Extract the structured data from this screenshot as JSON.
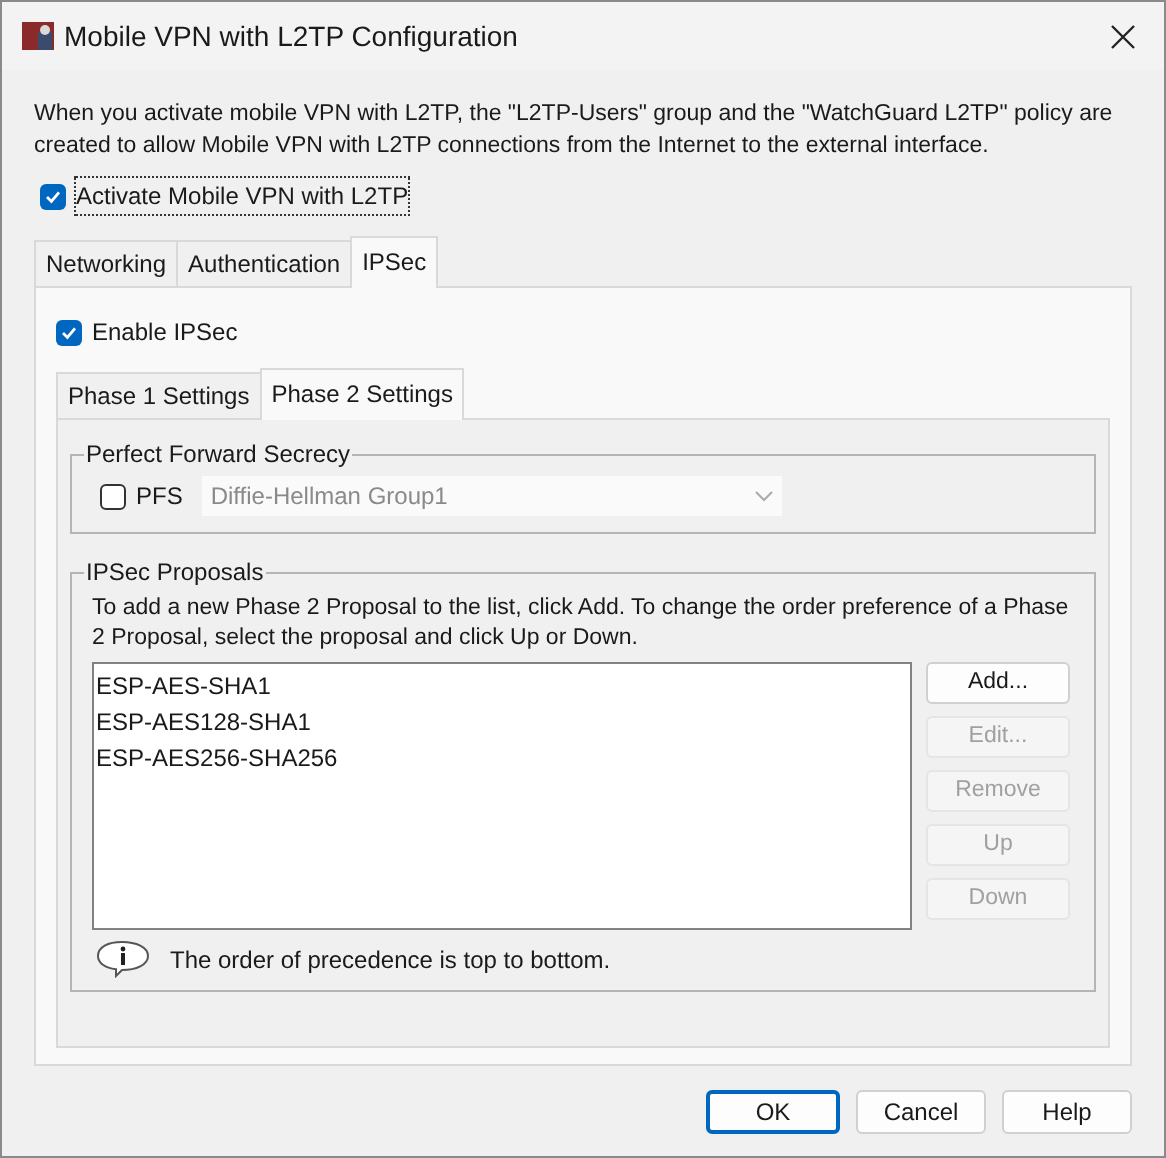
{
  "window": {
    "title": "Mobile VPN with L2TP Configuration"
  },
  "description": "When you activate mobile VPN with L2TP, the \"L2TP-Users\" group and the \"WatchGuard L2TP\" policy are created to allow Mobile VPN with L2TP connections from the Internet to the external interface.",
  "activate": {
    "label": "Activate Mobile VPN with L2TP",
    "checked": true
  },
  "tabs": [
    {
      "label": "Networking",
      "selected": false
    },
    {
      "label": "Authentication",
      "selected": false
    },
    {
      "label": "IPSec",
      "selected": true
    }
  ],
  "enable_ipsec": {
    "label": "Enable IPSec",
    "checked": true
  },
  "subtabs": [
    {
      "label": "Phase 1 Settings",
      "selected": false
    },
    {
      "label": "Phase 2 Settings",
      "selected": true
    }
  ],
  "pfs_group": {
    "title": "Perfect Forward Secrecy",
    "pfs": {
      "label": "PFS",
      "checked": false
    },
    "dh_group": {
      "value": "Diffie-Hellman Group1",
      "disabled": true
    }
  },
  "proposals": {
    "title": "IPSec Proposals",
    "instructions": "To add a new Phase 2 Proposal to the list, click Add. To change the order preference of a Phase 2 Proposal, select the proposal and click Up or Down.",
    "items": [
      "ESP-AES-SHA1",
      "ESP-AES128-SHA1",
      "ESP-AES256-SHA256"
    ],
    "buttons": [
      {
        "label": "Add...",
        "disabled": false
      },
      {
        "label": "Edit...",
        "disabled": true
      },
      {
        "label": "Remove",
        "disabled": true
      },
      {
        "label": "Up",
        "disabled": true
      },
      {
        "label": "Down",
        "disabled": true
      }
    ],
    "note": "The order of precedence is top to bottom."
  },
  "buttons": [
    {
      "label": "OK",
      "default": true
    },
    {
      "label": "Cancel",
      "default": false
    },
    {
      "label": "Help",
      "default": false
    }
  ]
}
